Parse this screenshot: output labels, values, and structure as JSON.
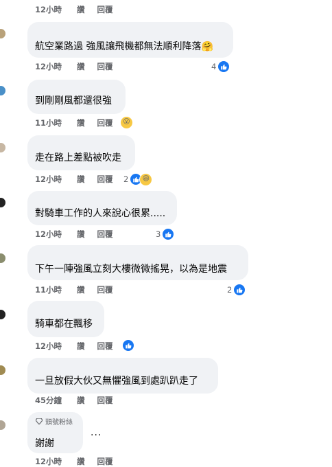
{
  "top_meta": {
    "time": "12小時",
    "like": "讚",
    "reply": "回覆"
  },
  "comments": [
    {
      "text": "航空業路過 強風讓飛機都無法順利降落",
      "emoji": "🤗",
      "time": "12小時",
      "like": "讚",
      "reply": "回覆",
      "count": "4"
    },
    {
      "text": "到剛剛風都還很強",
      "time": "11小時",
      "like": "讚",
      "reply": "回覆",
      "reaction_emoji": "😮"
    },
    {
      "text": "走在路上差點被吹走",
      "time": "12小時",
      "like": "讚",
      "reply": "回覆",
      "count": "2",
      "reaction_emoji": "😆"
    },
    {
      "text": "對騎車工作的人來說心很累.....",
      "time": "12小時",
      "like": "讚",
      "reply": "回覆",
      "count": "3"
    },
    {
      "text": "下午一陣強風立刻大樓微微搖晃，以為是地震",
      "time": "11小時",
      "like": "讚",
      "reply": "回覆",
      "count": "2"
    },
    {
      "text": "騎車都在飄移",
      "time": "12小時",
      "like": "讚",
      "reply": "回覆"
    },
    {
      "text": "一旦放假大伙又無懼強風到處趴趴走了",
      "time": "45分鐘",
      "like": "讚",
      "reply": "回覆"
    },
    {
      "badge": "頭號粉絲",
      "text": "謝謝",
      "time": "12小時",
      "like": "讚",
      "reply": "回覆"
    }
  ],
  "more_label": "...",
  "colors": {
    "like_blue": "#1877f2",
    "bubble": "#f0f2f5",
    "meta": "#65676b"
  }
}
